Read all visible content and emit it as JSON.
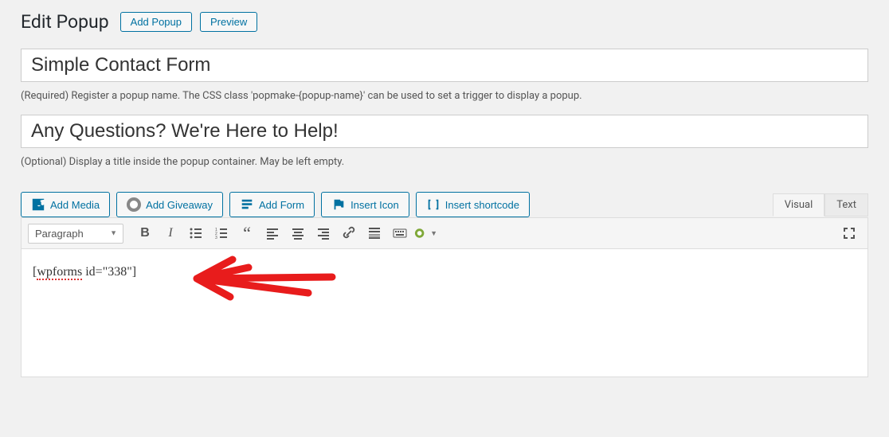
{
  "header": {
    "title": "Edit Popup",
    "add_button": "Add Popup",
    "preview_button": "Preview"
  },
  "fields": {
    "popup_name_value": "Simple Contact Form",
    "popup_name_help": "(Required) Register a popup name. The CSS class 'popmake-{popup-name}' can be used to set a trigger to display a popup.",
    "popup_title_value": "Any Questions? We're Here to Help!",
    "popup_title_help": "(Optional) Display a title inside the popup container. May be left empty."
  },
  "media_buttons": {
    "add_media": "Add Media",
    "add_giveaway": "Add Giveaway",
    "add_form": "Add Form",
    "insert_icon": "Insert Icon",
    "insert_shortcode": "Insert shortcode"
  },
  "tabs": {
    "visual": "Visual",
    "text": "Text"
  },
  "editor": {
    "format_selected": "Paragraph",
    "content_shortcode": "[wpforms id=\"338\"]"
  }
}
